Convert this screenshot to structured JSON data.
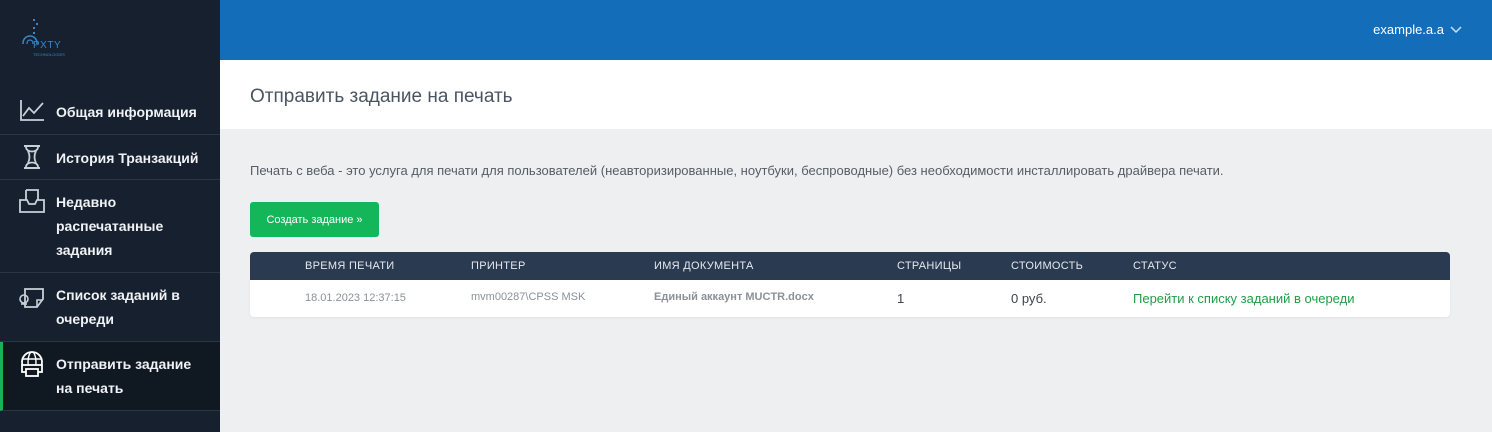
{
  "brand": {
    "logo_text": "PXTY",
    "logo_sub": "TECHNOLOGIES"
  },
  "sidebar": {
    "items": [
      {
        "label": "Общая информация",
        "icon": "chart-line-icon"
      },
      {
        "label": "История Транзакций",
        "icon": "hourglass-icon"
      },
      {
        "label": "Недавно распечатанные задания",
        "icon": "inbox-tray-icon"
      },
      {
        "label": "Список заданий в очереди",
        "icon": "printer-queue-icon"
      },
      {
        "label": "Отправить задание на печать",
        "icon": "web-print-icon",
        "active": true
      }
    ]
  },
  "topbar": {
    "username": "example.a.a"
  },
  "page": {
    "title": "Отправить задание на печать",
    "description": "Печать с веба - это услуга для печати для пользователей (неавторизированные, ноутбуки, беспроводные) без необходимости инсталлировать драйвера печати.",
    "create_button": "Создать задание »"
  },
  "table": {
    "headers": [
      "ВРЕМЯ ПЕЧАТИ",
      "ПРИНТЕР",
      "ИМЯ ДОКУМЕНТА",
      "СТРАНИЦЫ",
      "СТОИМОСТЬ",
      "СТАТУС"
    ],
    "rows": [
      {
        "time": "18.01.2023 12:37:15",
        "printer": "mvm00287\\CPSS MSK",
        "document": "Единый аккаунт MUCTR.docx",
        "pages": "1",
        "cost": "0 руб.",
        "status": "Перейти к списку заданий в очереди"
      }
    ]
  },
  "colors": {
    "sidebar": "#16202e",
    "topbar": "#136db8",
    "accent": "#13b75a",
    "table_header": "#2a3a50",
    "status_link": "#1f9e47"
  }
}
